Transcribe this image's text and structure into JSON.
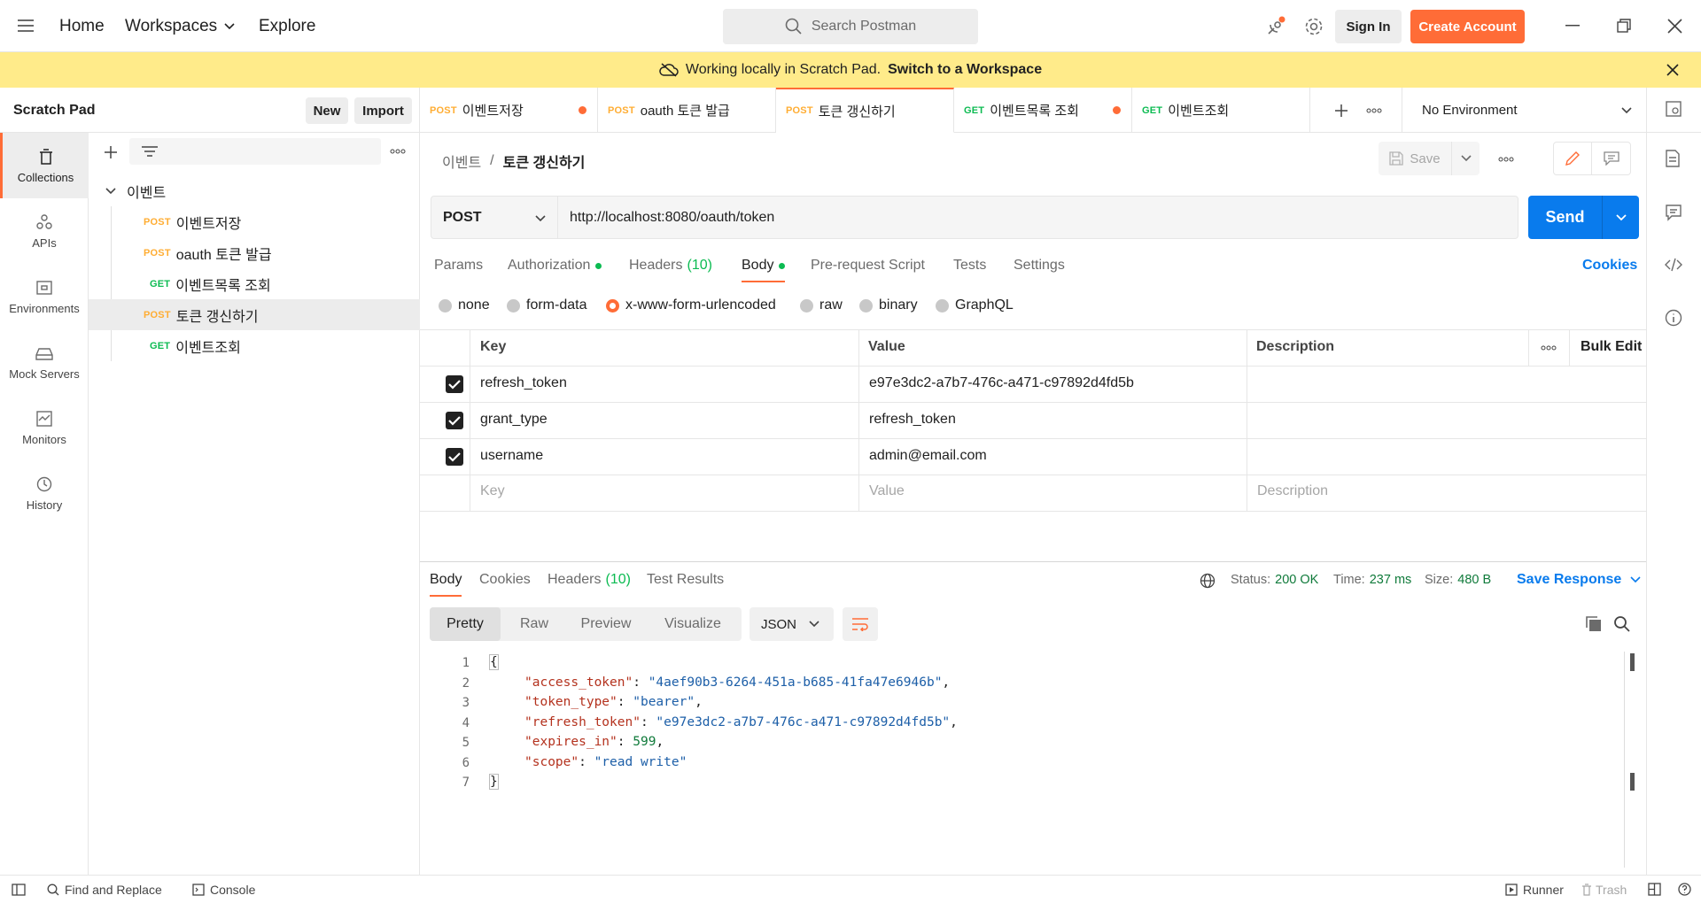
{
  "header": {
    "home": "Home",
    "workspaces": "Workspaces",
    "explore": "Explore",
    "search_placeholder": "Search Postman",
    "sign_in": "Sign In",
    "create_account": "Create Account"
  },
  "banner": {
    "text": "Working locally in Scratch Pad.",
    "link": "Switch to a Workspace"
  },
  "sidebar": {
    "title": "Scratch Pad",
    "new_label": "New",
    "import_label": "Import",
    "rail": [
      {
        "label": "Collections"
      },
      {
        "label": "APIs"
      },
      {
        "label": "Environments"
      },
      {
        "label": "Mock Servers"
      },
      {
        "label": "Monitors"
      },
      {
        "label": "History"
      }
    ],
    "collection_name": "이벤트",
    "requests": [
      {
        "method": "POST",
        "name": "이벤트저장"
      },
      {
        "method": "POST",
        "name": "oauth 토큰 발급"
      },
      {
        "method": "GET",
        "name": "이벤트목록 조회"
      },
      {
        "method": "POST",
        "name": "토큰 갱신하기"
      },
      {
        "method": "GET",
        "name": "이벤트조회"
      }
    ]
  },
  "tabs": [
    {
      "method": "POST",
      "name": "이벤트저장"
    },
    {
      "method": "POST",
      "name": "oauth 토큰 발급"
    },
    {
      "method": "POST",
      "name": "토큰 갱신하기"
    },
    {
      "method": "GET",
      "name": "이벤트목록 조회"
    },
    {
      "method": "GET",
      "name": "이벤트조회"
    }
  ],
  "environment": "No Environment",
  "request": {
    "breadcrumb_parent": "이벤트",
    "breadcrumb_sep": "/",
    "breadcrumb_current": "토큰 갱신하기",
    "save_label": "Save",
    "method": "POST",
    "url": "http://localhost:8080/oauth/token",
    "send_label": "Send",
    "tabs": {
      "params": "Params",
      "authorization": "Authorization",
      "headers": "Headers",
      "headers_count": "(10)",
      "body": "Body",
      "prerequest": "Pre-request Script",
      "tests": "Tests",
      "settings": "Settings",
      "cookies": "Cookies"
    },
    "body_types": [
      "none",
      "form-data",
      "x-www-form-urlencoded",
      "raw",
      "binary",
      "GraphQL"
    ],
    "table": {
      "headers": {
        "key": "Key",
        "value": "Value",
        "description": "Description",
        "bulk_edit": "Bulk Edit"
      },
      "rows": [
        {
          "key": "refresh_token",
          "value": "e97e3dc2-a7b7-476c-a471-c97892d4fd5b",
          "description": ""
        },
        {
          "key": "grant_type",
          "value": "refresh_token",
          "description": ""
        },
        {
          "key": "username",
          "value": "admin@email.com",
          "description": ""
        }
      ],
      "placeholders": {
        "key": "Key",
        "value": "Value",
        "description": "Description"
      }
    }
  },
  "response": {
    "tabs": {
      "body": "Body",
      "cookies": "Cookies",
      "headers": "Headers",
      "headers_count": "(10)",
      "test_results": "Test Results"
    },
    "status_label": "Status:",
    "status_value": "200 OK",
    "time_label": "Time:",
    "time_value": "237 ms",
    "size_label": "Size:",
    "size_value": "480 B",
    "save_response": "Save Response",
    "views": [
      "Pretty",
      "Raw",
      "Preview",
      "Visualize"
    ],
    "format": "JSON",
    "lines": [
      {
        "n": "1",
        "text": "{"
      },
      {
        "n": "2",
        "key": "\"access_token\"",
        "val": "\"4aef90b3-6264-451a-b685-41fa47e6946b\"",
        "end": ","
      },
      {
        "n": "3",
        "key": "\"token_type\"",
        "val": "\"bearer\"",
        "end": ","
      },
      {
        "n": "4",
        "key": "\"refresh_token\"",
        "val": "\"e97e3dc2-a7b7-476c-a471-c97892d4fd5b\"",
        "end": ","
      },
      {
        "n": "5",
        "key": "\"expires_in\"",
        "num": "599",
        "end": ","
      },
      {
        "n": "6",
        "key": "\"scope\"",
        "val": "\"read write\"",
        "end": ""
      },
      {
        "n": "7",
        "text": "}"
      }
    ]
  },
  "footer": {
    "find_replace": "Find and Replace",
    "console": "Console",
    "runner": "Runner",
    "trash": "Trash"
  },
  "colors": {
    "accent": "#ff6c37",
    "send": "#097bed",
    "post": "#ffad33",
    "get": "#0cbb52",
    "banner": "#ffeb8a"
  }
}
